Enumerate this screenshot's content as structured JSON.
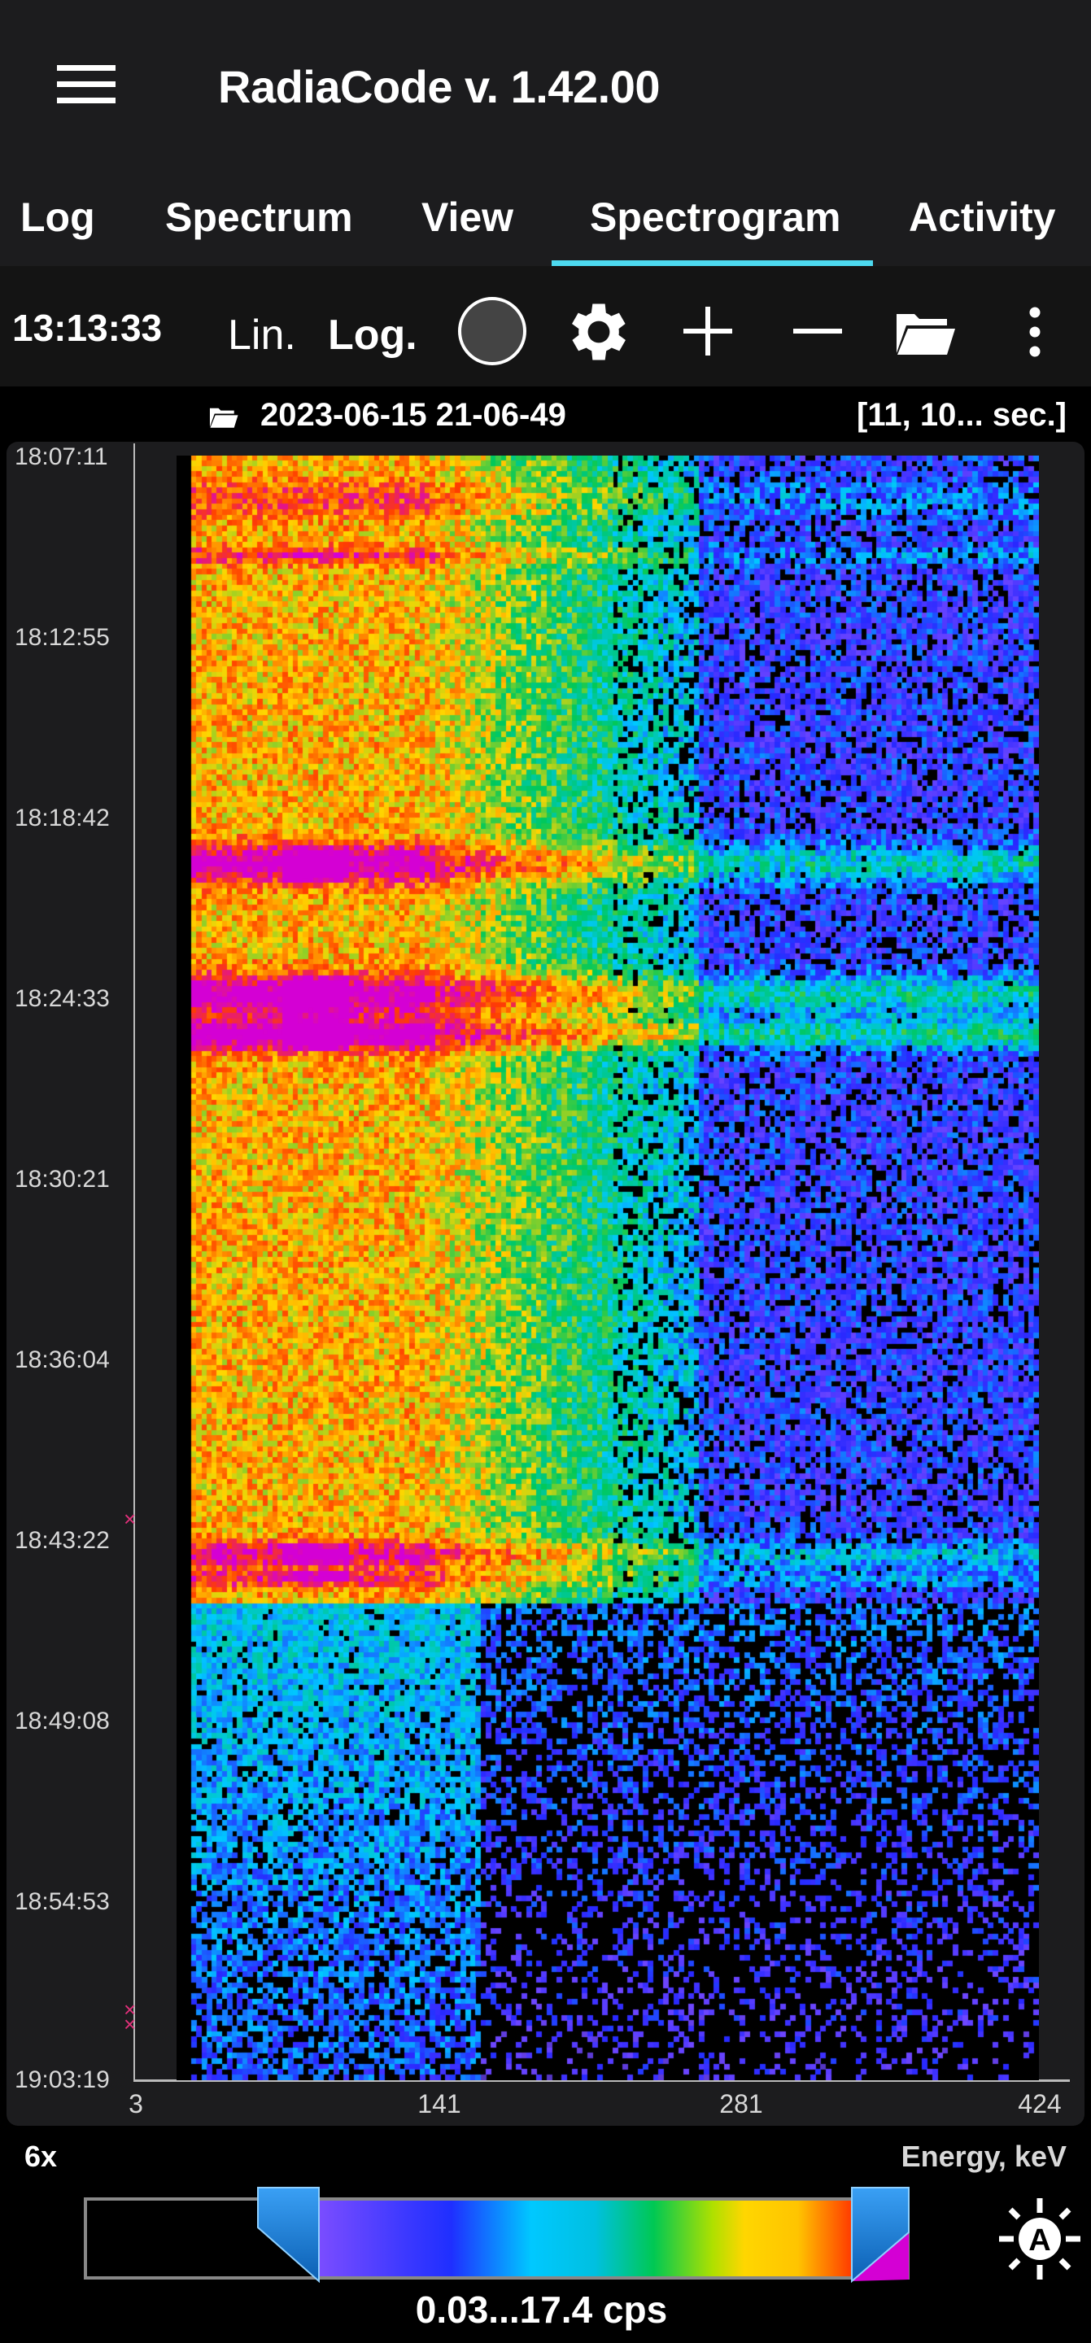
{
  "app": {
    "title": "RadiaCode v. 1.42.00"
  },
  "tabs": [
    {
      "label": "Log"
    },
    {
      "label": "Spectrum"
    },
    {
      "label": "View"
    },
    {
      "label": "Spectrogram",
      "active": true
    },
    {
      "label": "Activity"
    }
  ],
  "toolbar": {
    "time": "13:13:33",
    "lin_label": "Lin.",
    "log_label": "Log.",
    "scale_selected": "Log.",
    "icons": [
      "record-circle-icon",
      "gear-icon",
      "plus-icon",
      "minus-icon",
      "folder-open-icon",
      "more-vert-icon"
    ]
  },
  "file": {
    "name": "2023-06-15 21-06-49",
    "interval": "[11, 10... sec.]"
  },
  "chart_data": {
    "type": "heatmap",
    "xlabel": "Energy, keV",
    "x_ticks": [
      "3",
      "141",
      "281",
      "424"
    ],
    "y_ticks": [
      "18:07:11",
      "18:12:55",
      "18:18:42",
      "18:24:33",
      "18:30:21",
      "18:36:04",
      "18:43:22",
      "18:49:08",
      "18:54:53",
      "19:03:19"
    ],
    "colormap": [
      "#000000",
      "#7b4dff",
      "#1f2fff",
      "#00c8ff",
      "#00c853",
      "#ffd600",
      "#ff3d00",
      "#d400d4"
    ],
    "color_range": "0.03...17.4 cps",
    "scale": "log"
  },
  "footer": {
    "zoom": "6x",
    "axis_label": "Energy, keV",
    "range": "0.03...17.4 cps"
  },
  "colors": {
    "accent": "#4dd9ef",
    "header_bg": "#1c1c1e",
    "panel_bg": "#1c1c1e",
    "marker": "#e0307a"
  }
}
